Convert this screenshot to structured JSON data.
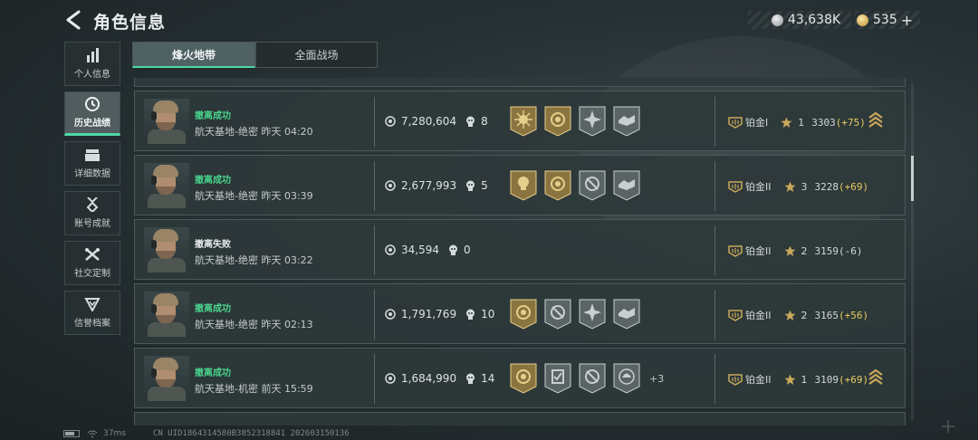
{
  "header": {
    "title": "角色信息",
    "currency_silver": "43,638K",
    "currency_gold": "535",
    "plus": "+"
  },
  "sidebar": {
    "items": [
      {
        "label": "个人信息",
        "icon": "bar-chart-icon",
        "active": false
      },
      {
        "label": "历史战绩",
        "icon": "clock-icon",
        "active": true
      },
      {
        "label": "详细数据",
        "icon": "folder-icon",
        "active": false
      },
      {
        "label": "账号成就",
        "icon": "medal-icon",
        "active": false
      },
      {
        "label": "社交定制",
        "icon": "wrench-icon",
        "active": false
      },
      {
        "label": "信誉档案",
        "icon": "shield-icon",
        "active": false
      }
    ]
  },
  "tabs": [
    {
      "label": "烽火地带",
      "active": true
    },
    {
      "label": "全面战场",
      "active": false
    }
  ],
  "records": [
    {
      "status": "撤离成功",
      "success": true,
      "map": "航天基地-绝密",
      "time": "昨天 04:20",
      "value": "7,280,604",
      "kills": "8",
      "badges": [
        "gold-sunburst-badge",
        "gold-crosshair-badge",
        "silver-star-badge",
        "silver-handshake-badge"
      ],
      "more": "",
      "rank": "铂金I",
      "stars": "1",
      "score": "3303",
      "delta": "(+75)",
      "delta_positive": true,
      "chevrons": true
    },
    {
      "status": "撤离成功",
      "success": true,
      "map": "航天基地-绝密",
      "time": "昨天 03:39",
      "value": "2,677,993",
      "kills": "5",
      "badges": [
        "gold-skull-badge",
        "gold-crosshair-badge",
        "silver-no-target-badge",
        "silver-handshake-badge"
      ],
      "more": "",
      "rank": "铂金II",
      "stars": "3",
      "score": "3228",
      "delta": "(+69)",
      "delta_positive": true,
      "chevrons": false
    },
    {
      "status": "撤离失败",
      "success": false,
      "map": "航天基地-绝密",
      "time": "昨天 03:22",
      "value": "34,594",
      "kills": "0",
      "badges": [],
      "more": "",
      "rank": "铂金II",
      "stars": "2",
      "score": "3159",
      "delta": "(-6)",
      "delta_positive": false,
      "chevrons": false
    },
    {
      "status": "撤离成功",
      "success": true,
      "map": "航天基地-绝密",
      "time": "昨天 02:13",
      "value": "1,791,769",
      "kills": "10",
      "badges": [
        "gold-crosshair-badge",
        "silver-no-target-badge",
        "silver-star-badge",
        "silver-handshake-badge"
      ],
      "more": "",
      "rank": "铂金II",
      "stars": "2",
      "score": "3165",
      "delta": "(+56)",
      "delta_positive": true,
      "chevrons": false
    },
    {
      "status": "撤离成功",
      "success": true,
      "map": "航天基地-机密",
      "time": "前天 15:59",
      "value": "1,684,990",
      "kills": "14",
      "badges": [
        "gold-crosshair-badge",
        "silver-checklist-badge",
        "silver-no-target-badge",
        "silver-helmet-badge"
      ],
      "more": "+3",
      "rank": "铂金II",
      "stars": "1",
      "score": "3109",
      "delta": "(+69)",
      "delta_positive": true,
      "chevrons": true
    }
  ],
  "footer": {
    "ping": "37ms",
    "uid": "CN UID1864314580B3852318841 202603150136"
  },
  "colors": {
    "accent_green": "#4fd8a4",
    "success_text": "#49d38c",
    "gold": "#c9a85b",
    "positive_delta": "#e8cd5f"
  }
}
